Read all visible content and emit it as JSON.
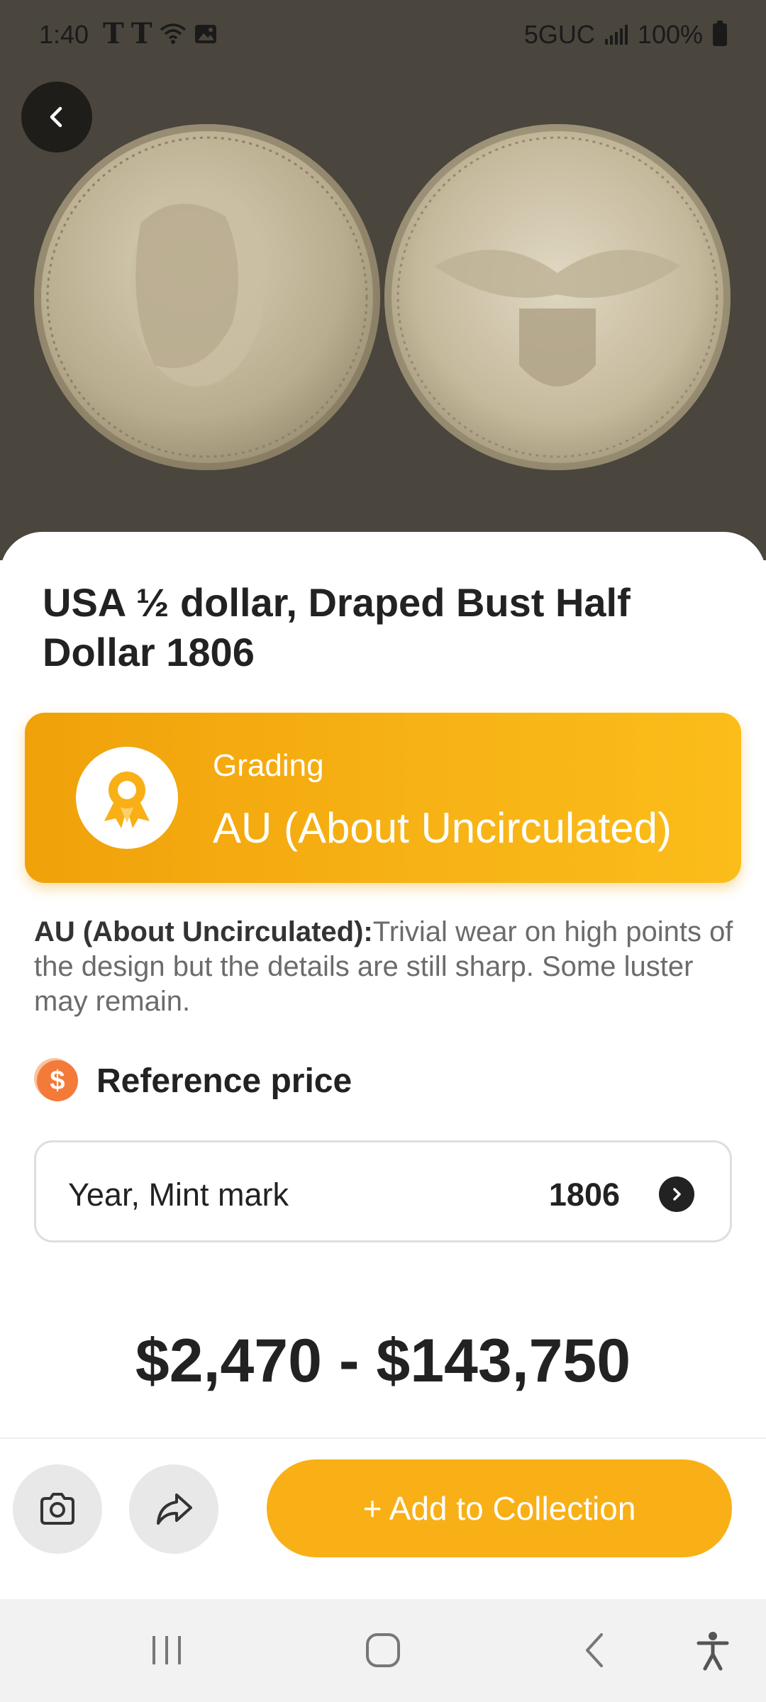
{
  "status_bar": {
    "time": "1:40",
    "network": "5GUC",
    "battery": "100%"
  },
  "coin": {
    "obverse_image": "coin-obverse",
    "reverse_image": "coin-reverse"
  },
  "title": "USA ½ dollar, Draped Bust Half Dollar 1806",
  "grading": {
    "label": "Grading",
    "value": "AU (About Uncirculated)"
  },
  "description": {
    "term": "AU (About Uncirculated):",
    "text": "Trivial wear on high points of the design but the details are still sharp. Some luster may remain."
  },
  "reference": {
    "title": "Reference price",
    "icon": "dollar-icon"
  },
  "year_mint": {
    "label": "Year, Mint mark",
    "value": "1806"
  },
  "price_range": "$2,470 - $143,750",
  "actions": {
    "add_label": "+ Add to Collection"
  },
  "colors": {
    "accent": "#f8b016",
    "grade_start": "#f0a10a",
    "grade_end": "#fbbd1a",
    "ref_icon": "#f47a3a"
  }
}
